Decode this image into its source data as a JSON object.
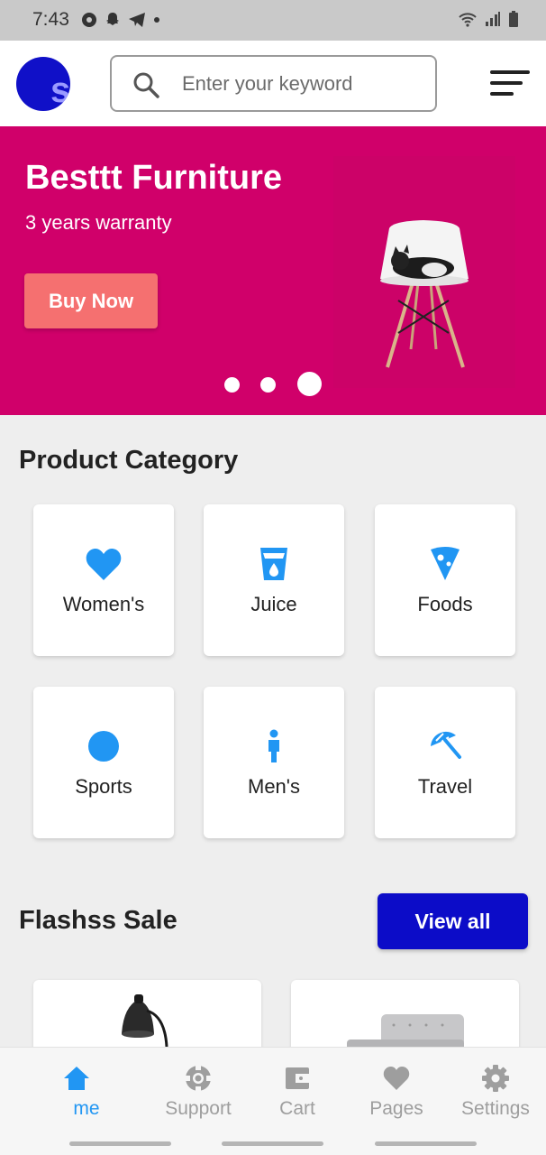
{
  "status_bar": {
    "time": "7:43"
  },
  "header": {
    "logo_letter": "s",
    "search": {
      "placeholder": "Enter your keyword",
      "value": ""
    }
  },
  "banner": {
    "title": "Besttt Furniture",
    "subtitle": "3 years warranty",
    "cta_label": "Buy Now",
    "background_color": "#d0006a",
    "cta_color": "#f57070",
    "slide_count": 3,
    "active_slide": 3
  },
  "categories": {
    "title": "Product Category",
    "items": [
      {
        "label": "Women's",
        "icon": "heart-icon"
      },
      {
        "label": "Juice",
        "icon": "cup-icon"
      },
      {
        "label": "Foods",
        "icon": "pizza-icon"
      },
      {
        "label": "Sports",
        "icon": "ball-icon"
      },
      {
        "label": "Men's",
        "icon": "man-icon"
      },
      {
        "label": "Travel",
        "icon": "beach-umbrella-icon"
      }
    ],
    "icon_color": "#2196f3"
  },
  "flash_sale": {
    "title": "Flashss Sale",
    "view_all_label": "View all",
    "button_color": "#0c0cc8"
  },
  "bottom_nav": {
    "items": [
      {
        "label": "me",
        "icon": "home-icon",
        "active": true
      },
      {
        "label": "Support",
        "icon": "lifebuoy-icon",
        "active": false
      },
      {
        "label": "Cart",
        "icon": "wallet-icon",
        "active": false
      },
      {
        "label": "Pages",
        "icon": "heart-icon",
        "active": false
      },
      {
        "label": "Settings",
        "icon": "gear-icon",
        "active": false
      }
    ],
    "active_color": "#2196f3"
  }
}
